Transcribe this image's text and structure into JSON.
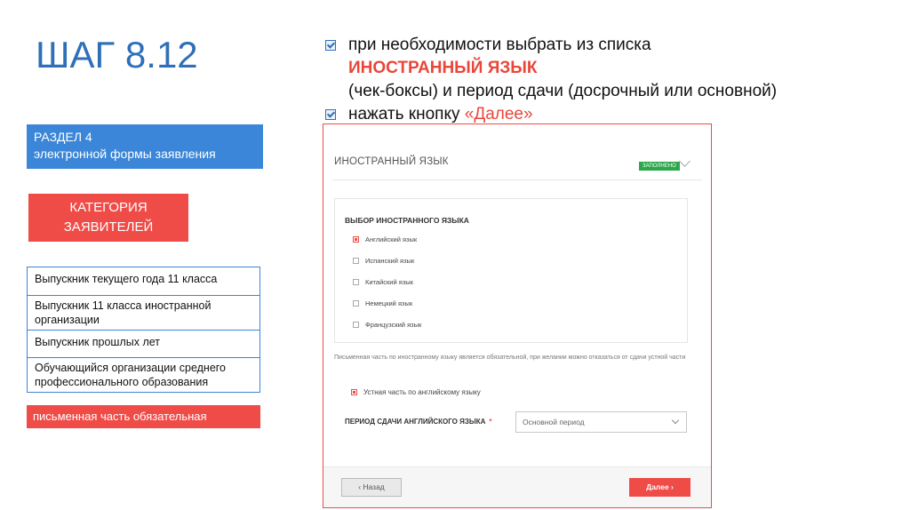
{
  "step_title": "ШАГ 8.12",
  "instructions": {
    "line1": "при необходимости выбрать из списка",
    "line2_highlight": "ИНОСТРАННЫЙ ЯЗЫК",
    "line3": "(чек-боксы) и период сдачи (досрочный или основной)",
    "line4_prefix": "нажать кнопку ",
    "line4_highlight": "«Далее»"
  },
  "section_box": {
    "line1": "РАЗДЕЛ 4",
    "line2": "электронной формы заявления"
  },
  "category_box": {
    "line1": "КАТЕГОРИЯ",
    "line2": "ЗАЯВИТЕЛЕЙ"
  },
  "categories": [
    "Выпускник текущего года 11 класса",
    "Выпускник 11 класса иностранной организации",
    "Выпускник прошлых лет",
    "Обучающийся организации среднего профессионального образования"
  ],
  "written_badge": "письменная часть обязательная",
  "form": {
    "header_title": "ИНОСТРАННЫЙ ЯЗЫК",
    "status_badge": "ЗАПОЛНЕНО",
    "lang_section_title": "ВЫБОР ИНОСТРАННОГО ЯЗЫКА",
    "languages": [
      {
        "label": "Английский язык",
        "checked": true
      },
      {
        "label": "Испанский язык",
        "checked": false
      },
      {
        "label": "Китайский язык",
        "checked": false
      },
      {
        "label": "Немецкий язык",
        "checked": false
      },
      {
        "label": "Французский язык",
        "checked": false
      }
    ],
    "note": "Письменная часть по иностранному языку является обязательной, при желании можно отказаться от сдачи устной части",
    "oral_part_label": "Устная часть по английскому языку",
    "oral_part_checked": true,
    "period_label": "ПЕРИОД СДАЧИ АНГЛИЙСКОГО ЯЗЫКА",
    "period_required_mark": "*",
    "period_value": "Основной период",
    "back_button": "‹ Назад",
    "next_button": "Далее ›"
  },
  "colors": {
    "title_blue": "#2f6fb8",
    "accent_red": "#ef4c48",
    "section_blue": "#3b86d8",
    "status_green": "#2ba84a"
  }
}
